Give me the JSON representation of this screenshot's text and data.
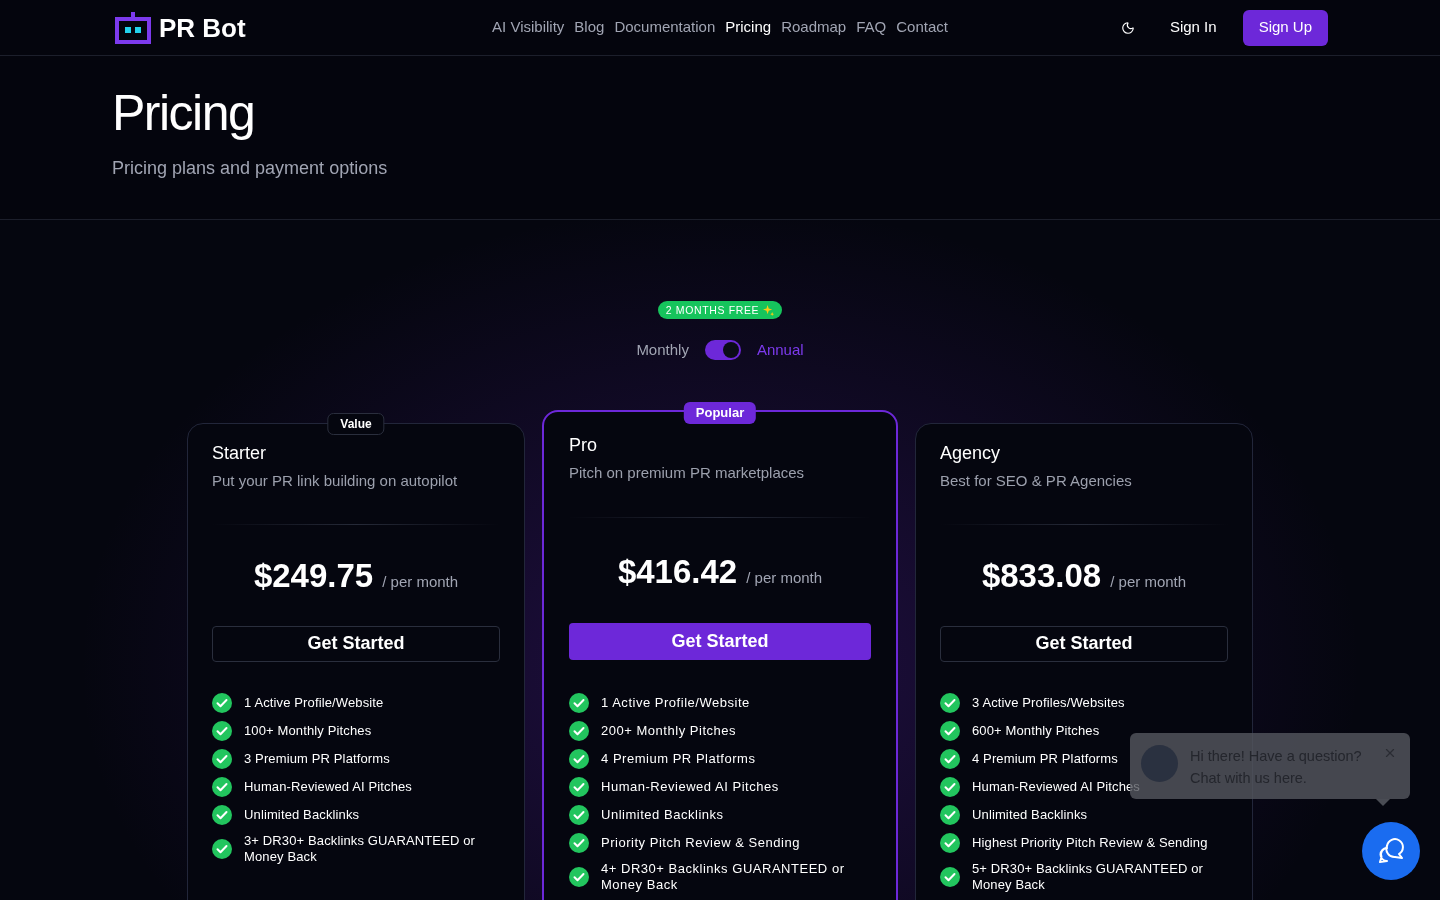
{
  "header": {
    "logo_text": "PR Bot",
    "nav": [
      {
        "label": "AI Visibility",
        "selected": false
      },
      {
        "label": "Blog",
        "selected": false
      },
      {
        "label": "Documentation",
        "selected": false
      },
      {
        "label": "Pricing",
        "selected": true
      },
      {
        "label": "Roadmap",
        "selected": false
      },
      {
        "label": "FAQ",
        "selected": false
      },
      {
        "label": "Contact",
        "selected": false
      }
    ],
    "sign_in": "Sign In",
    "sign_up": "Sign Up"
  },
  "page_header": {
    "title": "Pricing",
    "subtitle": "Pricing plans and payment options"
  },
  "billing": {
    "promo_badge": "2 MONTHS FREE",
    "options": [
      {
        "label": "Monthly",
        "selected": false
      },
      {
        "label": "Annual",
        "selected": true
      }
    ]
  },
  "plans": [
    {
      "name": "Starter",
      "description": "Put your PR link building on autopilot",
      "badge": "Value",
      "highlighted": false,
      "price": "$249.75",
      "period": "/ per month",
      "button": "Get Started",
      "features": [
        "1 Active Profile/Website",
        "100+ Monthly Pitches",
        "3 Premium PR Platforms",
        "Human-Reviewed AI Pitches",
        "Unlimited Backlinks",
        "3+ DR30+ Backlinks GUARANTEED or Money Back"
      ]
    },
    {
      "name": "Pro",
      "description": "Pitch on premium PR marketplaces",
      "badge": "Popular",
      "highlighted": true,
      "price": "$416.42",
      "period": "/ per month",
      "button": "Get Started",
      "features": [
        "1 Active Profile/Website",
        "200+ Monthly Pitches",
        "4 Premium PR Platforms",
        "Human-Reviewed AI Pitches",
        "Unlimited Backlinks",
        "Priority Pitch Review & Sending",
        "4+ DR30+ Backlinks GUARANTEED or Money Back"
      ]
    },
    {
      "name": "Agency",
      "description": "Best for SEO & PR Agencies",
      "highlighted": false,
      "price": "$833.08",
      "period": "/ per month",
      "button": "Get Started",
      "features": [
        "3 Active Profiles/Websites",
        "600+ Monthly Pitches",
        "4 Premium PR Platforms",
        "Human-Reviewed AI Pitches",
        "Unlimited Backlinks",
        "Highest Priority Pitch Review & Sending",
        "5+ DR30+ Backlinks GUARANTEED or Money Back"
      ]
    }
  ],
  "chat": {
    "message": "Hi there! Have a question? Chat with us here."
  }
}
